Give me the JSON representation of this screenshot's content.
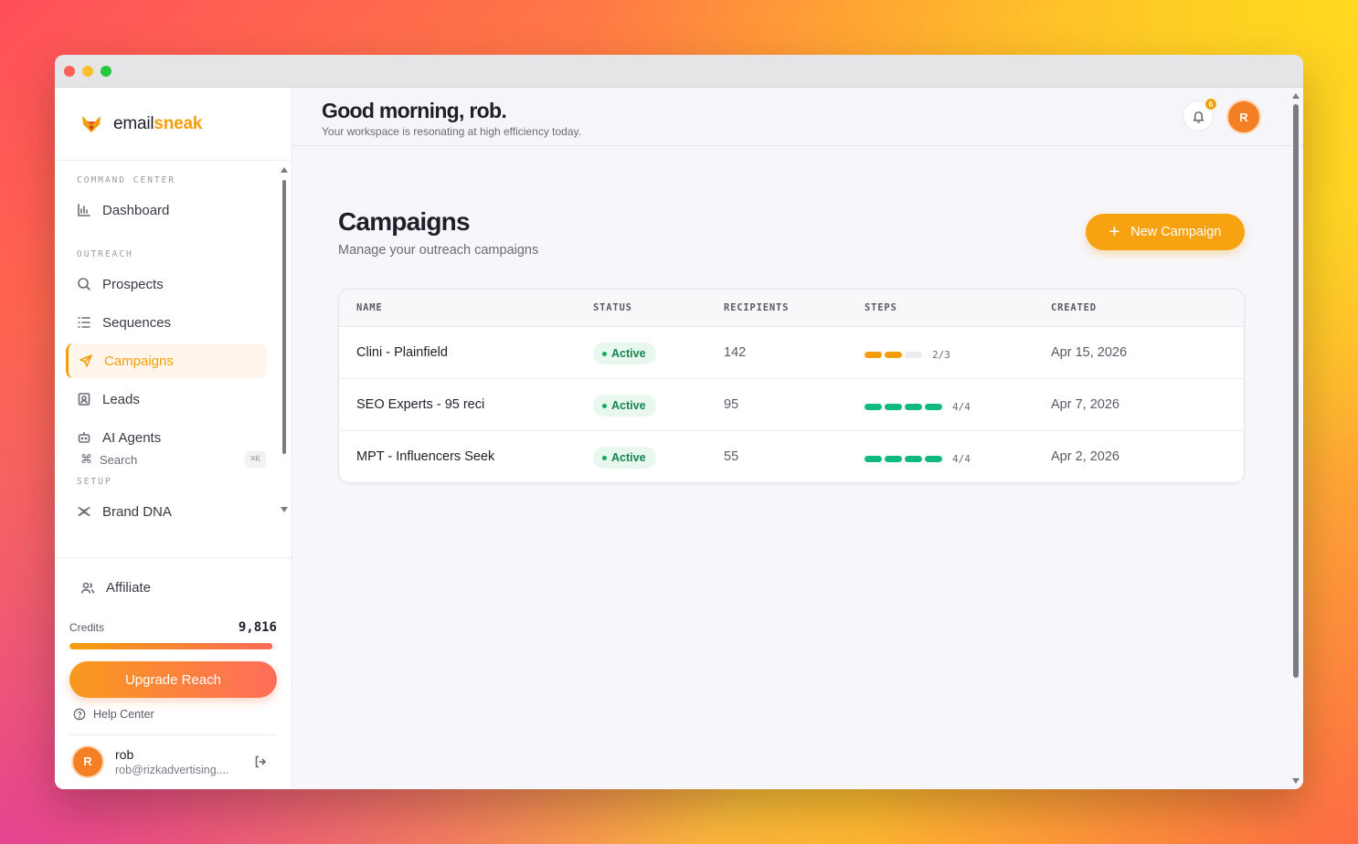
{
  "brand": {
    "name_prefix": "email",
    "name_accent": "sneak"
  },
  "sidebar": {
    "sections": {
      "command_center": "COMMAND CENTER",
      "outreach": "OUTREACH",
      "setup": "SETUP"
    },
    "items": [
      {
        "label": "Dashboard",
        "icon": "bar-chart-icon"
      },
      {
        "label": "Prospects",
        "icon": "search-icon"
      },
      {
        "label": "Sequences",
        "icon": "list-icon"
      },
      {
        "label": "Campaigns",
        "icon": "send-icon",
        "active": true
      },
      {
        "label": "Leads",
        "icon": "contact-icon"
      },
      {
        "label": "AI Agents",
        "icon": "bot-icon"
      },
      {
        "label": "Brand DNA",
        "icon": "dna-icon"
      }
    ],
    "search": {
      "label": "Search",
      "shortcut": "⌘K"
    },
    "affiliate": "Affiliate",
    "credits": {
      "label": "Credits",
      "value": "9,816",
      "fill_fraction": 0.98
    },
    "upgrade": "Upgrade Reach",
    "help": "Help Center",
    "user": {
      "initial": "R",
      "name": "rob",
      "email": "rob@rizkadvertising...."
    }
  },
  "topbar": {
    "greeting": "Good morning, rob.",
    "subtitle": "Your workspace is resonating at high efficiency today.",
    "notifications": "6",
    "avatar_initial": "R"
  },
  "page": {
    "title": "Campaigns",
    "subtitle": "Manage your outreach campaigns",
    "new_button": "New Campaign"
  },
  "table": {
    "columns": [
      "NAME",
      "STATUS",
      "RECIPIENTS",
      "STEPS",
      "CREATED"
    ],
    "rows": [
      {
        "name": "Clini - Plainfield",
        "status": "Active",
        "recipients": "142",
        "steps_done": 2,
        "steps_total": 3,
        "steps_label": "2/3",
        "step_color": "#f59e0b",
        "created": "Apr 15, 2026"
      },
      {
        "name": "SEO Experts - 95 reci",
        "status": "Active",
        "recipients": "95",
        "steps_done": 4,
        "steps_total": 4,
        "steps_label": "4/4",
        "step_color": "#10b981",
        "created": "Apr 7, 2026"
      },
      {
        "name": "MPT - Influencers Seek",
        "status": "Active",
        "recipients": "55",
        "steps_done": 4,
        "steps_total": 4,
        "steps_label": "4/4",
        "step_color": "#10b981",
        "created": "Apr 2, 2026"
      }
    ]
  },
  "colors": {
    "accent": "#f59e0b",
    "success": "#10b981"
  }
}
